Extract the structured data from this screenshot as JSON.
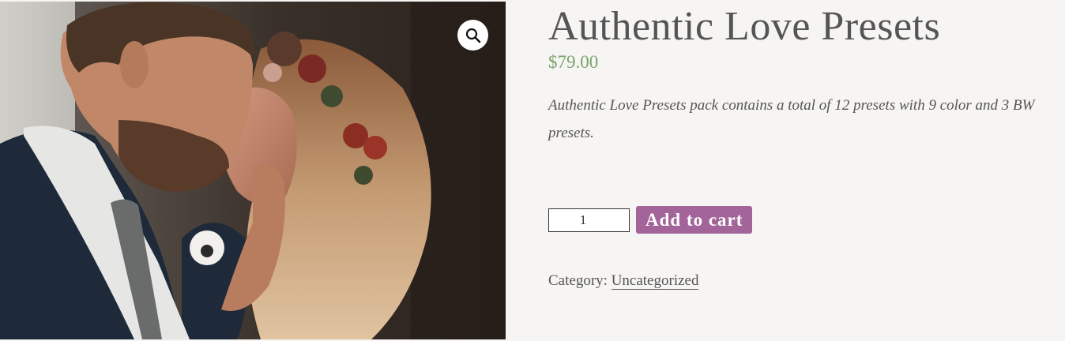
{
  "product": {
    "title": "Authentic Love Presets",
    "price": "$79.00",
    "description": "Authentic Love Presets pack contains a total of 12 presets with 9 color and 3 BW presets.",
    "quantity": "1",
    "add_to_cart_label": "Add to cart",
    "category_label": "Category:",
    "category_value": "Uncategorized"
  },
  "icons": {
    "zoom": "magnifier-icon"
  },
  "colors": {
    "price": "#7aa36a",
    "button": "#a3649a",
    "background": "#f6f5f3"
  }
}
